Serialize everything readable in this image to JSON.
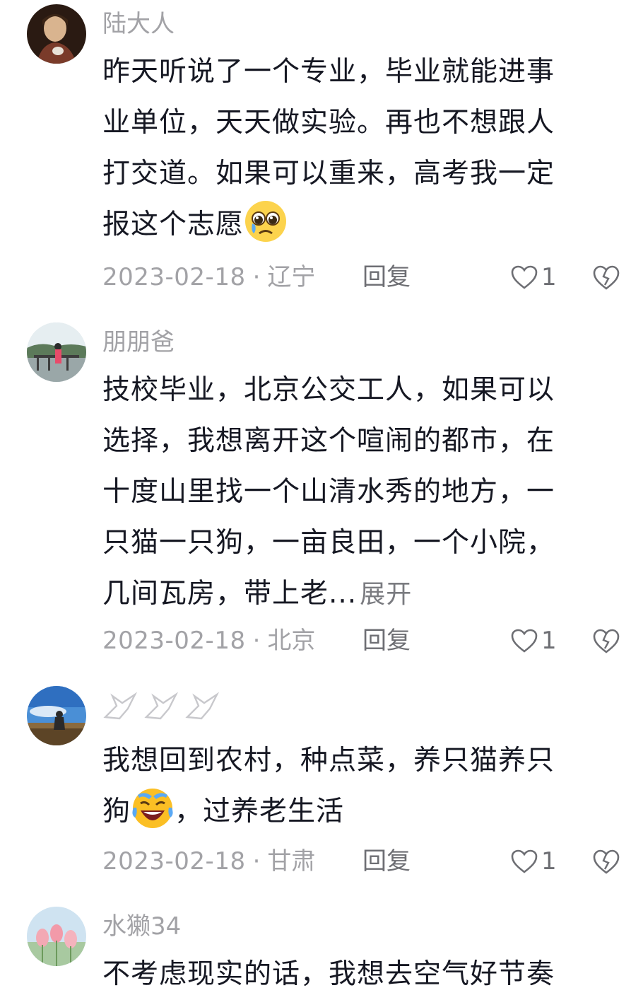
{
  "comments": [
    {
      "username": "陆大人",
      "lines": [
        "昨天听说了一个专业，毕业就能进事",
        "业单位，天天做实验。再也不想跟人",
        "打交道。如果可以重来，高考我一定",
        "报这个志愿"
      ],
      "emoji": "pleading-face-icon",
      "date": "2023-02-18",
      "location": "辽宁",
      "reply": "回复",
      "likes": "1"
    },
    {
      "username": "朋朋爸",
      "lines": [
        "技校毕业，北京公交工人，如果可以",
        "选择，我想离开这个喧闹的都市，在",
        "十度山里找一个山清水秀的地方，一",
        "只猫一只狗，一亩良田，一个小院，",
        "几间瓦房，带上老..."
      ],
      "expand": "展开",
      "date": "2023-02-18",
      "location": "北京",
      "reply": "回复",
      "likes": "1"
    },
    {
      "username": "",
      "lines": [
        "我想回到农村，种点菜，养只猫养只",
        "，过养老生活"
      ],
      "line2_prefix": "狗",
      "emoji": "crying-laughing-face-icon",
      "date": "2023-02-18",
      "location": "甘肃",
      "reply": "回复",
      "likes": "1"
    },
    {
      "username": "水獭34",
      "lines": [
        "不考虑现实的话，我想去空气好节奏"
      ]
    }
  ],
  "separator": "·",
  "colors": {
    "text": "#161823",
    "muted": "#a2a2a6",
    "action": "#6d6e73"
  }
}
